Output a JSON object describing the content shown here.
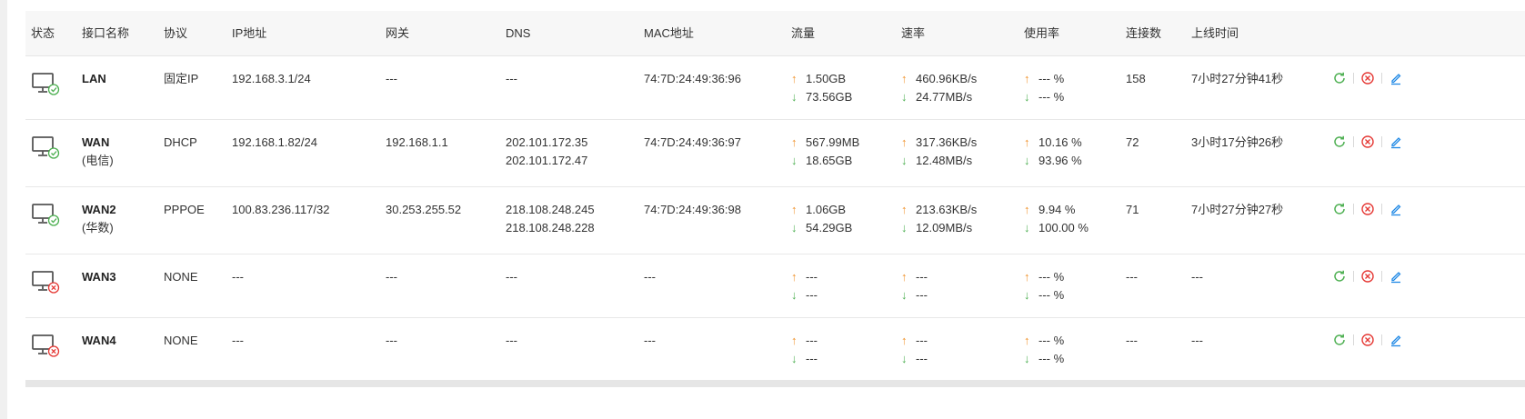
{
  "columns": {
    "status": "状态",
    "name": "接口名称",
    "protocol": "协议",
    "ip": "IP地址",
    "gateway": "网关",
    "dns": "DNS",
    "mac": "MAC地址",
    "flow": "流量",
    "rate": "速率",
    "usage": "使用率",
    "connections": "连接数",
    "online_time": "上线时间"
  },
  "colors": {
    "up_arrow": "#f0922c",
    "down_arrow": "#4caf50",
    "status_ok": "#4caf50",
    "status_error": "#e53935",
    "action_refresh": "#4caf50",
    "action_disconnect": "#e53935",
    "action_edit": "#1e88e5"
  },
  "rows": [
    {
      "status": "connected",
      "status_icon": "monitor-check-icon",
      "name": "LAN",
      "name_sub": "",
      "protocol": "固定IP",
      "ip": "192.168.3.1/24",
      "gateway": "---",
      "dns": [
        "---",
        ""
      ],
      "mac": "74:7D:24:49:36:96",
      "flow_up": "1.50GB",
      "flow_down": "73.56GB",
      "rate_up": "460.96KB/s",
      "rate_down": "24.77MB/s",
      "usage_up": "--- %",
      "usage_down": "--- %",
      "connections": "158",
      "online_time": "7小时27分钟41秒"
    },
    {
      "status": "connected",
      "status_icon": "monitor-check-icon",
      "name": "WAN",
      "name_sub": "(电信)",
      "protocol": "DHCP",
      "ip": "192.168.1.82/24",
      "gateway": "192.168.1.1",
      "dns": [
        "202.101.172.35",
        "202.101.172.47"
      ],
      "mac": "74:7D:24:49:36:97",
      "flow_up": "567.99MB",
      "flow_down": "18.65GB",
      "rate_up": "317.36KB/s",
      "rate_down": "12.48MB/s",
      "usage_up": "10.16 %",
      "usage_down": "93.96 %",
      "connections": "72",
      "online_time": "3小时17分钟26秒"
    },
    {
      "status": "connected",
      "status_icon": "monitor-check-icon",
      "name": "WAN2",
      "name_sub": "(华数)",
      "protocol": "PPPOE",
      "ip": "100.83.236.117/32",
      "gateway": "30.253.255.52",
      "dns": [
        "218.108.248.245",
        "218.108.248.228"
      ],
      "mac": "74:7D:24:49:36:98",
      "flow_up": "1.06GB",
      "flow_down": "54.29GB",
      "rate_up": "213.63KB/s",
      "rate_down": "12.09MB/s",
      "usage_up": "9.94 %",
      "usage_down": "100.00 %",
      "connections": "71",
      "online_time": "7小时27分钟27秒"
    },
    {
      "status": "disconnected",
      "status_icon": "monitor-error-icon",
      "name": "WAN3",
      "name_sub": "",
      "protocol": "NONE",
      "ip": "---",
      "gateway": "---",
      "dns": [
        "---",
        ""
      ],
      "mac": "---",
      "flow_up": "---",
      "flow_down": "---",
      "rate_up": "---",
      "rate_down": "---",
      "usage_up": "--- %",
      "usage_down": "--- %",
      "connections": "---",
      "online_time": "---"
    },
    {
      "status": "disconnected",
      "status_icon": "monitor-error-icon",
      "name": "WAN4",
      "name_sub": "",
      "protocol": "NONE",
      "ip": "---",
      "gateway": "---",
      "dns": [
        "---",
        ""
      ],
      "mac": "---",
      "flow_up": "---",
      "flow_down": "---",
      "rate_up": "---",
      "rate_down": "---",
      "usage_up": "--- %",
      "usage_down": "--- %",
      "connections": "---",
      "online_time": "---"
    }
  ],
  "arrows": {
    "up": "↑",
    "down": "↓"
  }
}
